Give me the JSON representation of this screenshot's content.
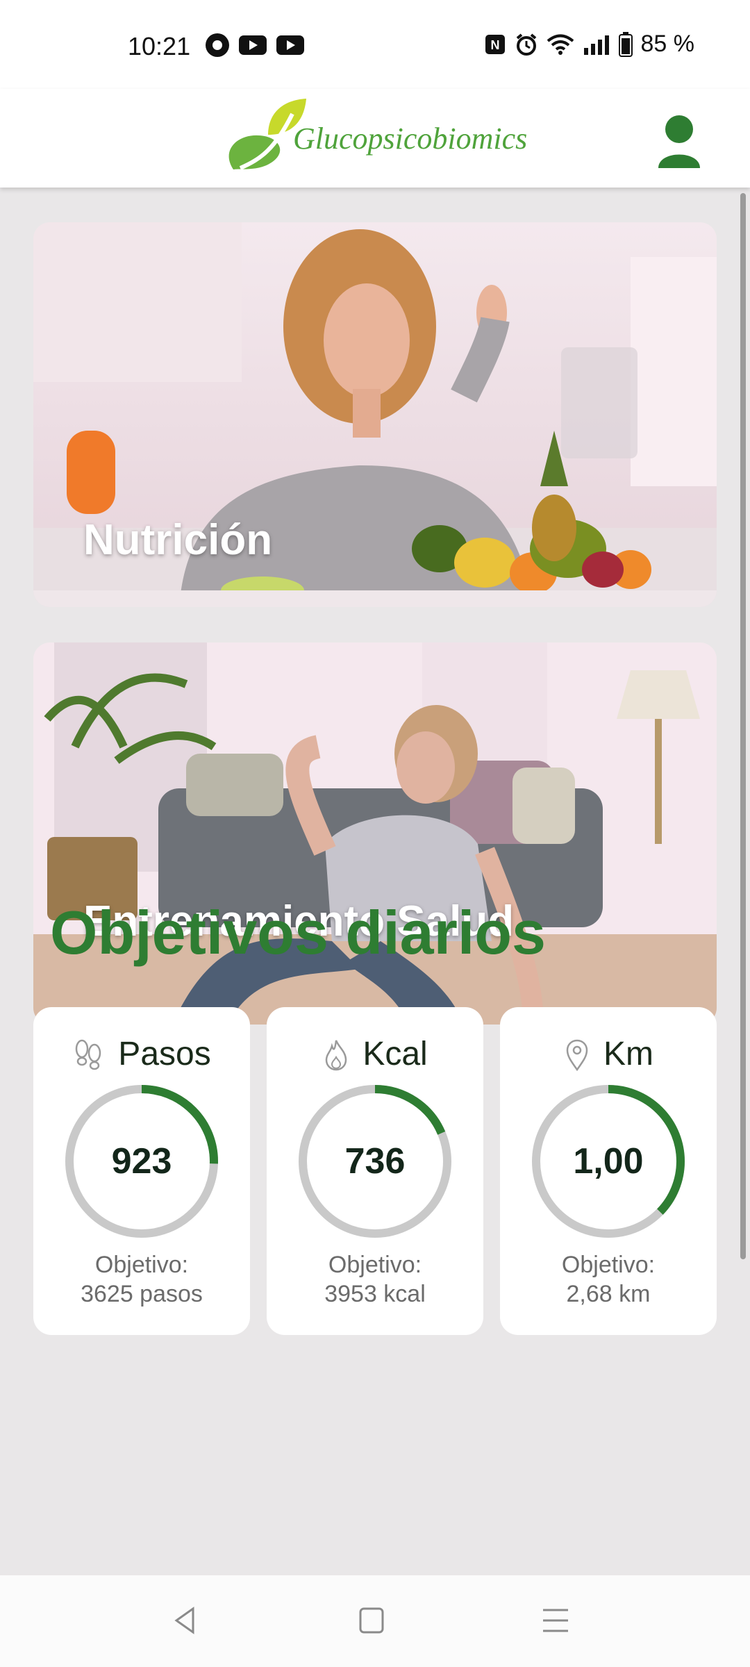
{
  "status": {
    "time": "10:21",
    "battery": "85 %"
  },
  "header": {
    "logo_text": "Glucopsicobiomics"
  },
  "banners": [
    {
      "label": "Nutrición"
    },
    {
      "label": "Entrenamiento Salud"
    }
  ],
  "section_title": "Objetivos diarios",
  "goals": [
    {
      "label": "Pasos",
      "icon": "footsteps-icon",
      "value": "923",
      "goal_line1": "Objetivo:",
      "goal_line2": "3625 pasos",
      "progress": 0.255
    },
    {
      "label": "Kcal",
      "icon": "flame-icon",
      "value": "736",
      "goal_line1": "Objetivo:",
      "goal_line2": "3953 kcal",
      "progress": 0.186
    },
    {
      "label": "Km",
      "icon": "location-pin-icon",
      "value": "1,00",
      "goal_line1": "Objetivo:",
      "goal_line2": "2,68 km",
      "progress": 0.373
    }
  ],
  "colors": {
    "accent": "#2e7d32",
    "ring_track": "#c9c9c9",
    "background": "#e9e7e8"
  },
  "nav": [
    "back-icon",
    "home-icon",
    "menu-icon"
  ]
}
